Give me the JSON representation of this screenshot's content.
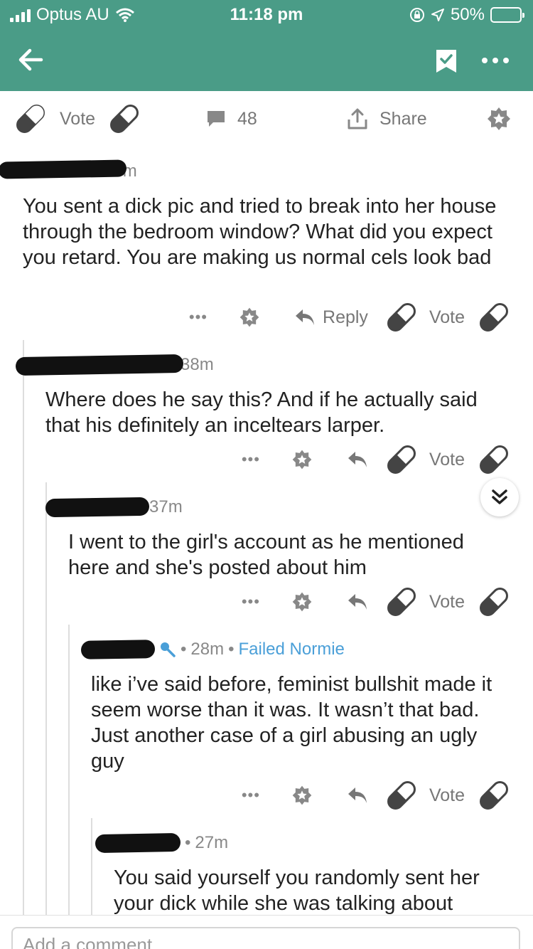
{
  "status_bar": {
    "carrier": "Optus AU",
    "time": "11:18 pm",
    "battery": "50%",
    "battery_level": 0.5
  },
  "post_actions": {
    "vote_label": "Vote",
    "comment_count": "48",
    "share_label": "Share"
  },
  "comments": [
    {
      "age": "45m",
      "text": "You sent a dick pic and tried to break into her house through the bedroom window? What did you expect you retard. You are making us normal cels look bad",
      "reply_label": "Reply",
      "vote_label": "Vote",
      "more": "•••"
    },
    {
      "age": "38m",
      "text": "Where does he say this? And if he actually said that his definitely an inceltears larper.",
      "vote_label": "Vote",
      "more": "•••"
    },
    {
      "age": "37m",
      "text": "I went to the girl's account as he mentioned here and she's posted about him",
      "vote_label": "Vote",
      "more": "•••"
    },
    {
      "age": "28m",
      "flair": "Failed Normie",
      "text": "like i’ve said before, feminist bullshit made it seem worse than it was. It wasn’t that bad. Just another case of a girl abusing an ugly guy",
      "vote_label": "Vote",
      "more": "•••"
    },
    {
      "age": "27m",
      "text": "You said yourself you randomly sent her your dick while she was talking about"
    }
  ],
  "composer": {
    "placeholder": "Add a comment"
  },
  "icons": {
    "back": "arrow-left-icon",
    "bookmark": "bookmark-check-icon",
    "more": "more-dots-icon",
    "vote": "pill-vote-icon",
    "comment": "speech-bubble-icon",
    "share": "share-upload-icon",
    "award": "star-badge-icon",
    "reply": "reply-arrow-icon",
    "collapse": "double-chevron-down-icon"
  },
  "colors": {
    "header": "#4a9c87",
    "flair": "#4a9fd8",
    "icon_gray": "#777777",
    "icon_dark": "#444444"
  }
}
